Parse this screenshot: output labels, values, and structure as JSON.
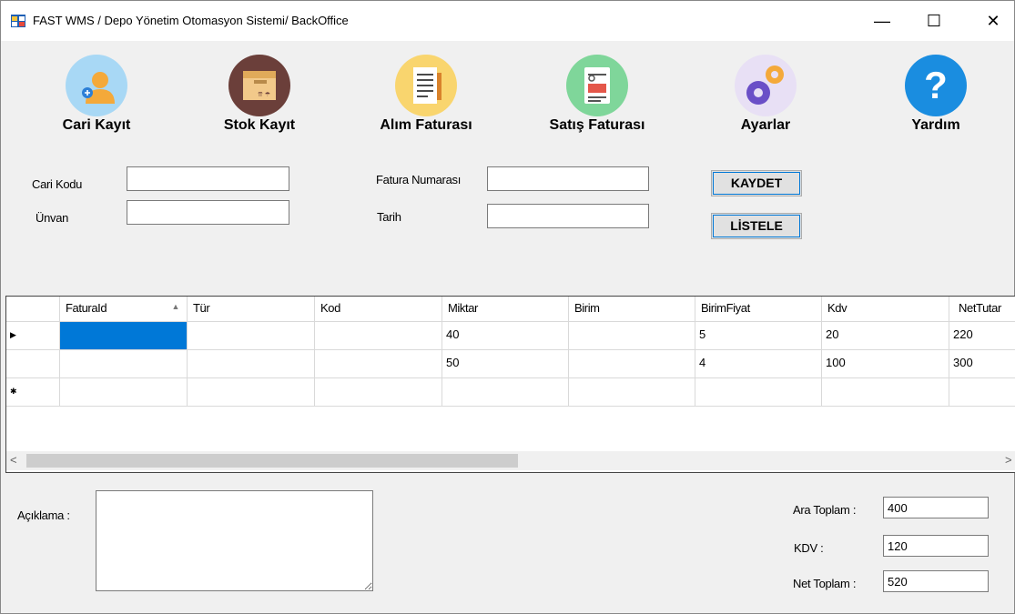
{
  "window": {
    "title": "FAST WMS / Depo Yönetim Otomasyon Sistemi/ BackOffice",
    "minimize": "—",
    "maximize": "☐",
    "close": "✕"
  },
  "toolbar": {
    "items": [
      {
        "label": "Cari Kayıt",
        "icon": "user-add-icon"
      },
      {
        "label": "Stok Kayıt",
        "icon": "box-icon"
      },
      {
        "label": "Alım Faturası",
        "icon": "document-icon"
      },
      {
        "label": "Satış Faturası",
        "icon": "invoice-icon"
      },
      {
        "label": "Ayarlar",
        "icon": "gears-icon"
      },
      {
        "label": "Yardım",
        "icon": "help-icon"
      }
    ]
  },
  "form": {
    "cari_kodu_label": "Cari Kodu",
    "unvan_label": "Ünvan",
    "fatura_numarasi_label": "Fatura Numarası",
    "tarih_label": "Tarih",
    "cari_kodu_value": "",
    "unvan_value": "",
    "fatura_numarasi_value": "",
    "tarih_value": "",
    "kaydet_label": "KAYDET",
    "listele_label": "LİSTELE"
  },
  "grid": {
    "columns": [
      "FaturaId",
      "Tür",
      "Kod",
      "Miktar",
      "Birim",
      "BirimFiyat",
      "Kdv",
      "NetTutar"
    ],
    "sort_indicator": "▲",
    "current_row_marker": "▶",
    "new_row_marker": "✱",
    "rows": [
      [
        "",
        "",
        "",
        "40",
        "",
        "5",
        "20",
        "220"
      ],
      [
        "",
        "",
        "",
        "50",
        "",
        "4",
        "100",
        "300"
      ],
      [
        "",
        "",
        "",
        "",
        "",
        "",
        "",
        ""
      ]
    ],
    "scroll_left": "<",
    "scroll_right": ">"
  },
  "footer": {
    "aciklama_label": "Açıklama :",
    "aciklama_value": "",
    "ara_toplam_label": "Ara Toplam :",
    "ara_toplam_value": "400",
    "kdv_label": "KDV :",
    "kdv_value": "120",
    "net_toplam_label": "Net Toplam :",
    "net_toplam_value": "520"
  }
}
